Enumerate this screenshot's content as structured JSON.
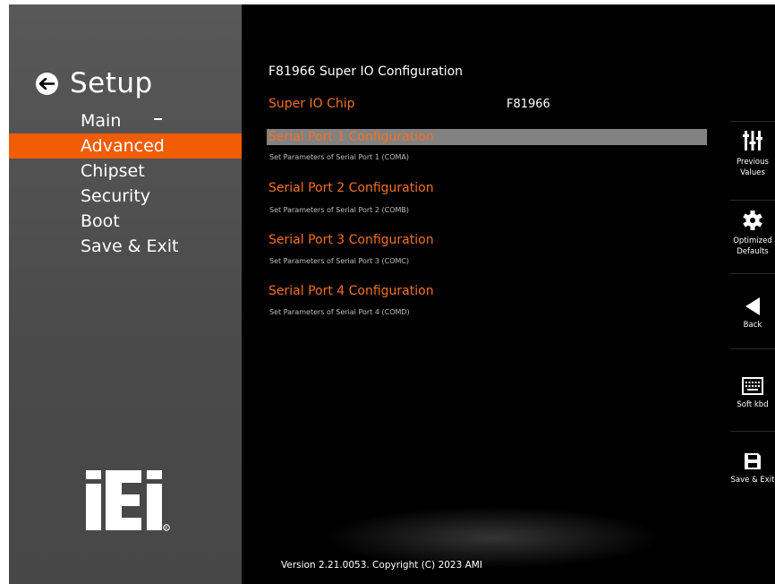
{
  "sidebar": {
    "title": "Setup",
    "menu": [
      {
        "label": "Main"
      },
      {
        "label": "Advanced"
      },
      {
        "label": "Chipset"
      },
      {
        "label": "Security"
      },
      {
        "label": "Boot"
      },
      {
        "label": "Save & Exit"
      }
    ],
    "logo_text": "iEi",
    "active_color": "#f25c05"
  },
  "content": {
    "page_title": "F81966 Super IO Configuration",
    "chip": {
      "label": "Super IO Chip",
      "value": "F81966"
    },
    "ports": [
      {
        "title": "Serial Port 1 Configuration",
        "desc": "Set Parameters of Serial Port 1 (COMA)"
      },
      {
        "title": "Serial Port 2 Configuration",
        "desc": "Set Parameters of Serial Port 2 (COMB)"
      },
      {
        "title": "Serial Port 3 Configuration",
        "desc": "Set Parameters of Serial Port 3 (COMC)"
      },
      {
        "title": "Serial Port 4 Configuration",
        "desc": "Set Parameters of Serial Port 4 (COMD)"
      }
    ],
    "version": "Version 2.21.0053. Copyright (C) 2023 AMI",
    "accent_color": "#f37021"
  },
  "actions": [
    {
      "icon": "sliders-icon",
      "label1": "Previous",
      "label2": "Values"
    },
    {
      "icon": "gear-icon",
      "label1": "Optimized",
      "label2": "Defaults"
    },
    {
      "icon": "back-arrow-icon",
      "label1": "Back",
      "label2": ""
    },
    {
      "icon": "keyboard-icon",
      "label1": "Soft kbd",
      "label2": ""
    },
    {
      "icon": "save-icon",
      "label1": "Save & Exit",
      "label2": ""
    }
  ]
}
